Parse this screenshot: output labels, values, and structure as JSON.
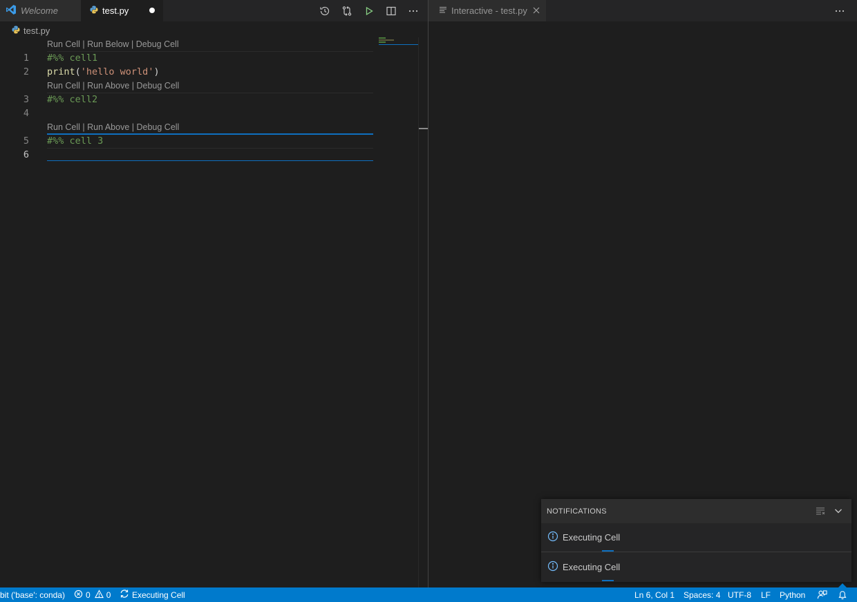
{
  "left_group": {
    "tabs": [
      {
        "label": "Welcome",
        "icon": "vscode-logo-icon",
        "active": false
      },
      {
        "label": "test.py",
        "icon": "python-file-icon",
        "active": true,
        "dirty": true
      }
    ],
    "actions": [
      "history-icon",
      "compare-changes-icon",
      "run-icon",
      "split-editor-icon",
      "more-actions-icon"
    ],
    "breadcrumb": "test.py"
  },
  "editor": {
    "codelens": [
      "Run Cell | Run Below | Debug Cell",
      "Run Cell | Run Above | Debug Cell",
      "Run Cell | Run Above | Debug Cell"
    ],
    "lines": [
      {
        "number": "1",
        "comment": "#%% cell1"
      },
      {
        "number": "2",
        "fn": "print",
        "open": "(",
        "str": "'hello world'",
        "close": ")"
      },
      {
        "number": "3",
        "comment": "#%% cell2"
      },
      {
        "number": "4"
      },
      {
        "number": "5",
        "comment": "#%% cell 3"
      },
      {
        "number": "6"
      }
    ],
    "current_line": "6"
  },
  "right_group": {
    "tab": {
      "label": "Interactive - test.py",
      "icon": "preview-icon"
    },
    "actions": [
      "more-actions-icon"
    ]
  },
  "notifications": {
    "title": "NOTIFICATIONS",
    "items": [
      {
        "icon": "info-icon",
        "message": "Executing Cell"
      },
      {
        "icon": "info-icon",
        "message": "Executing Cell"
      }
    ]
  },
  "statusbar": {
    "interpreter": "bit ('base': conda)",
    "errors": "0",
    "warnings": "0",
    "executing": "Executing Cell",
    "cursor": "Ln 6, Col 1",
    "spaces": "Spaces: 4",
    "encoding": "UTF-8",
    "eol": "LF",
    "language": "Python"
  },
  "colors": {
    "accent": "#007acc",
    "comment": "#6a9955",
    "function": "#dcdcaa",
    "string": "#ce9178"
  }
}
